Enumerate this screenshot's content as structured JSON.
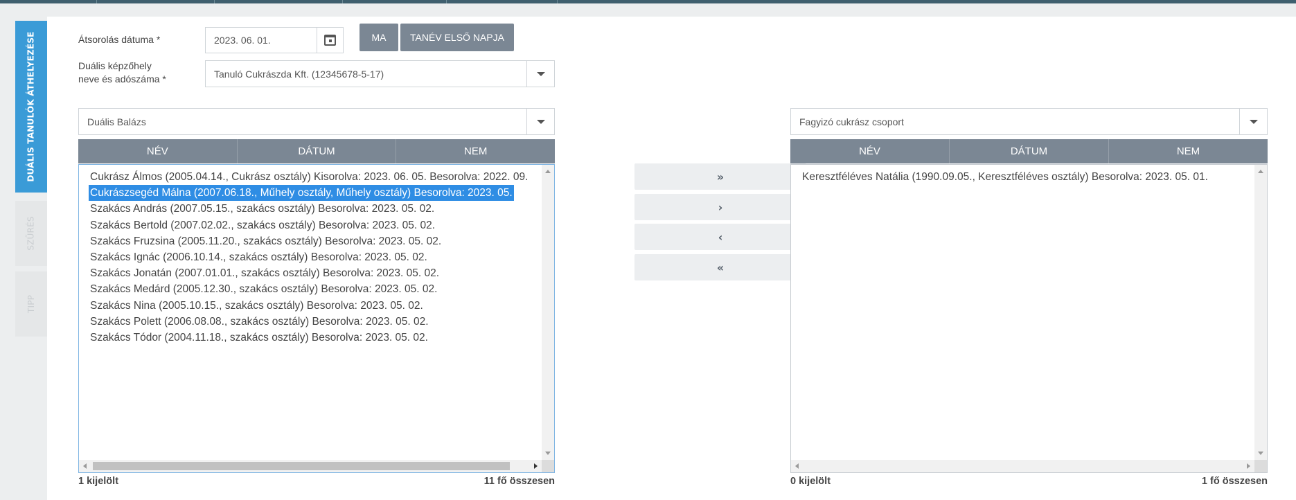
{
  "sidebar": {
    "tabs": [
      {
        "label": "DUÁLIS TANULÓK ÁTHELYEZÉSE",
        "active": true
      },
      {
        "label": "SZŰRÉS",
        "active": false
      },
      {
        "label": "TIPP",
        "active": false
      }
    ]
  },
  "form": {
    "date_label": "Átsorolás dátuma *",
    "date_value": "2023. 06. 01.",
    "today_button": "MA",
    "school_year_first_day_button": "TANÉV ELSŐ NAPJA",
    "workplace_label_line1": "Duális képzőhely",
    "workplace_label_line2": "neve és adószáma *",
    "workplace_value": "Tanuló Cukrászda Kft. (12345678-5-17)"
  },
  "left_panel": {
    "group_value": "Duális Balázs",
    "columns": [
      "NÉV",
      "DÁTUM",
      "NEM"
    ],
    "items": [
      {
        "text": "Cukrász Álmos (2005.04.14., Cukrász osztály) Kisorolva: 2023. 06. 05. Besorolva: 2022. 09.",
        "selected": false
      },
      {
        "text": "Cukrászsegéd Málna (2007.06.18., Műhely osztály, Műhely osztály) Besorolva: 2023. 05.",
        "selected": true
      },
      {
        "text": "Szakács András (2007.05.15., szakács osztály) Besorolva: 2023. 05. 02.",
        "selected": false
      },
      {
        "text": "Szakács Bertold (2007.02.02., szakács osztály) Besorolva: 2023. 05. 02.",
        "selected": false
      },
      {
        "text": "Szakács Fruzsina (2005.11.20., szakács osztály) Besorolva: 2023. 05. 02.",
        "selected": false
      },
      {
        "text": "Szakács Ignác (2006.10.14., szakács osztály) Besorolva: 2023. 05. 02.",
        "selected": false
      },
      {
        "text": "Szakács Jonatán (2007.01.01., szakács osztály) Besorolva: 2023. 05. 02.",
        "selected": false
      },
      {
        "text": "Szakács Medárd (2005.12.30., szakács osztály) Besorolva: 2023. 05. 02.",
        "selected": false
      },
      {
        "text": "Szakács Nina (2005.10.15., szakács osztály) Besorolva: 2023. 05. 02.",
        "selected": false
      },
      {
        "text": "Szakács Polett (2006.08.08., szakács osztály) Besorolva: 2023. 05. 02.",
        "selected": false
      },
      {
        "text": "Szakács Tódor (2004.11.18., szakács osztály) Besorolva: 2023. 05. 02.",
        "selected": false
      }
    ],
    "selected_count": "1 kijelölt",
    "total_count": "11 fő összesen"
  },
  "transfer_buttons": [
    {
      "name": "move-all-right",
      "glyph": "»"
    },
    {
      "name": "move-right",
      "glyph": "›"
    },
    {
      "name": "move-left",
      "glyph": "‹"
    },
    {
      "name": "move-all-left",
      "glyph": "«"
    }
  ],
  "right_panel": {
    "group_value": "Fagyizó cukrász csoport",
    "columns": [
      "NÉV",
      "DÁTUM",
      "NEM"
    ],
    "items": [
      {
        "text": "Keresztféléves Natália (1990.09.05., Keresztféléves osztály) Besorolva: 2023. 05. 01.",
        "selected": false
      }
    ],
    "selected_count": "0 kijelölt",
    "total_count": "1 fő összesen"
  },
  "colors": {
    "accent": "#3a9bd7",
    "header": "#7b8794",
    "selection": "#2f8de4"
  }
}
